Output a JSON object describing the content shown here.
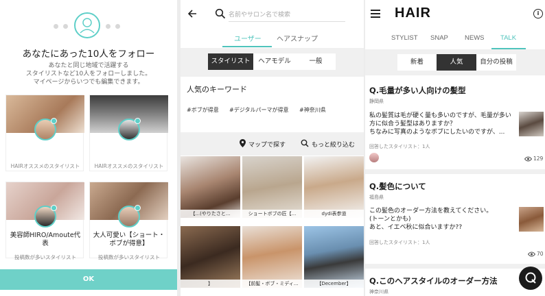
{
  "panel1": {
    "title": "あなたにあった10人をフォロー",
    "description": "あなたと同じ地域で活躍する\nスタイリストなど10人をフォローしました。\nマイページからいつでも編集できます。",
    "cards": [
      {
        "subtitle": "HAIRオススメのスタイリスト"
      },
      {
        "subtitle": "HAIRオススメのスタイリスト"
      },
      {
        "name": "美容師HIRO/Amoute代表",
        "subtitle": "投稿数が多いスタイリスト"
      },
      {
        "name": "大人可愛い【ショート・ボブが得意】",
        "subtitle": "投稿数が多いスタイリスト"
      }
    ],
    "ok_label": "OK"
  },
  "panel2": {
    "search_placeholder": "名前やサロン名で検索",
    "tabs": [
      "ユーザー",
      "ヘアスナップ"
    ],
    "segments": [
      "スタイリスト",
      "ヘアモデル",
      "一般"
    ],
    "keywords_title": "人気のキーワード",
    "keywords": [
      "#ボブが得意",
      "#デジタルパーマが得意",
      "#神奈川県"
    ],
    "map_link": "マップで探す",
    "filter_link": "もっと絞り込む",
    "photos": [
      {
        "label": "【...(やりたさと..."
      },
      {
        "label": "ショートボブの匠【..."
      },
      {
        "label": "dydi表参道"
      },
      {
        "label": "】"
      },
      {
        "label": "【前髪・ボブ・ミディ..."
      },
      {
        "label": "【December】"
      }
    ]
  },
  "panel3": {
    "logo": "HAIR",
    "tabs": [
      "STYLIST",
      "SNAP",
      "NEWS",
      "TALK"
    ],
    "segments": [
      "新着",
      "人気",
      "自分の投稿"
    ],
    "questions": [
      {
        "title": "Q.毛量が多い人向けの髪型",
        "location": "静岡県",
        "body": "私の髪質は毛が硬く量も多いのですが、毛量が多い方に似合う髪型はありますか？\nちなみに写真のようなボブにしたいのですが、...",
        "answered": "回答したスタイリスト：1人",
        "views": "129"
      },
      {
        "title": "Q.髪色について",
        "location": "福島県",
        "body": "この髪色のオーダー方法を教えてください。\n(トーンとかも)\nあと、イエベ秋に似合いますか??",
        "answered": "回答したスタイリスト：1人",
        "views": "70"
      },
      {
        "title": "Q.このヘアスタイルのオーダー方法",
        "location": "神奈川県"
      }
    ],
    "fab_label": "Q"
  },
  "colors": {
    "accent": "#4fc4bc",
    "ok_button": "#6fd1c8",
    "dark": "#333333"
  }
}
